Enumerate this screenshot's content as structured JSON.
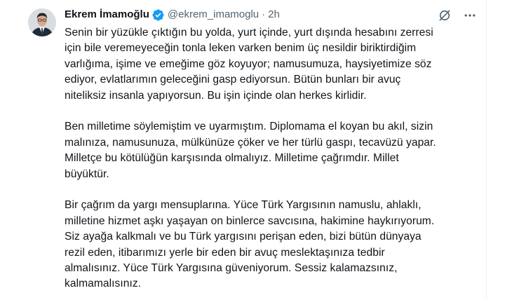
{
  "author": {
    "display_name": "Ekrem İmamoğlu",
    "handle": "@ekrem_imamoglu",
    "separator": "·",
    "time": "2h",
    "verified": true
  },
  "icons": {
    "verified": "verified-badge-icon",
    "grok": "grok-icon",
    "more": "more-icon"
  },
  "colors": {
    "verified_blue": "#1d9bf0",
    "text_primary": "#0f1419",
    "text_secondary": "#536471"
  },
  "tweet": {
    "paragraphs": [
      {
        "lines": [
          "Senin bir yüzükle çıktığın bu yolda, yurt içinde, yurt dışında hesabını zerresi",
          "için bile veremeyeceğin tonla leken varken benim üç nesildir biriktirdiğim",
          "varlığıma, işime ve emeğime göz koyuyor; namusumuza, haysiyetimize söz",
          "ediyor, evlatlarımın geleceğini gasp ediyorsun. Bütün bunları bir avuç",
          "niteliksiz insanla yapıyorsun. Bu işin içinde olan herkes kirlidir."
        ]
      },
      {
        "lines": [
          "Ben milletime söylemiştim ve uyarmıştım. Diplomama el koyan bu akıl, sizin",
          "malınıza, namusunuza, mülkünüze çöker ve her türlü gaspı, tecavüzü yapar.",
          "Milletçe bu kötülüğün karşısında olmalıyız. Milletime çağrımdır. Millet",
          "büyüktür."
        ]
      },
      {
        "lines": [
          "Bir çağrım da yargı mensuplarına. Yüce Türk Yargısının namuslu, ahlaklı,",
          "milletine hizmet aşkı yaşayan on binlerce savcısına, hakimine haykırıyorum.",
          "Siz ayağa kalkmalı ve bu Türk yargısını perişan eden, bizi bütün dünyaya",
          "rezil eden, itibarımızı yerle bir eden bir avuç meslektaşınıza tedbir",
          "almalısınız. Yüce Türk Yargısına güveniyorum. Sessiz kalamazsınız,",
          "kalmamalısınız."
        ]
      }
    ]
  }
}
